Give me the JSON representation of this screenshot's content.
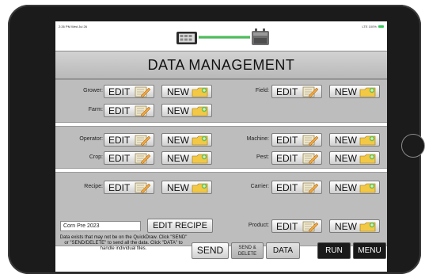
{
  "status_bar": {
    "time": "2:26 PM  Wed Jul 26",
    "indicators": "LTE 100%",
    "battery_color": "#34c759"
  },
  "header": {
    "title": "DATA MANAGEMENT"
  },
  "buttons": {
    "edit": "EDIT",
    "new": "NEW"
  },
  "sections": {
    "grower": {
      "label": "Grower:"
    },
    "farm": {
      "label": "Farm:"
    },
    "field": {
      "label": "Field:"
    },
    "operator": {
      "label": "Operator:"
    },
    "machine": {
      "label": "Machine:"
    },
    "crop": {
      "label": "Crop:"
    },
    "pest": {
      "label": "Pest:"
    },
    "recipe": {
      "label": "Recipe:"
    },
    "carrier": {
      "label": "Carrier:"
    },
    "product": {
      "label": "Product:"
    }
  },
  "recipe_field": {
    "value": "Corn Pre 2023"
  },
  "edit_recipe_button": "EDIT RECIPE",
  "notice_text": "Data exists that may not be on the QuickDraw. Click \"SEND\" or \"SEND/DELETE\" to send all the data.  Click \"DATA\" to handle individual files.",
  "actions": {
    "send": "SEND",
    "send_delete_line1": "SEND &",
    "send_delete_line2": "DELETE",
    "data": "DATA",
    "run": "RUN",
    "menu": "MENU"
  },
  "colors": {
    "panel_bg": "#bdbdbd",
    "title_bg": "#c6c6c6",
    "dark_button": "#1a1a1a",
    "link_line": "#2fb34a"
  },
  "icons": {
    "edit": "pencil-notepad-icon",
    "new": "new-folder-icon",
    "tablet_device": "tablet-device-icon",
    "receiver": "receiver-box-icon"
  }
}
